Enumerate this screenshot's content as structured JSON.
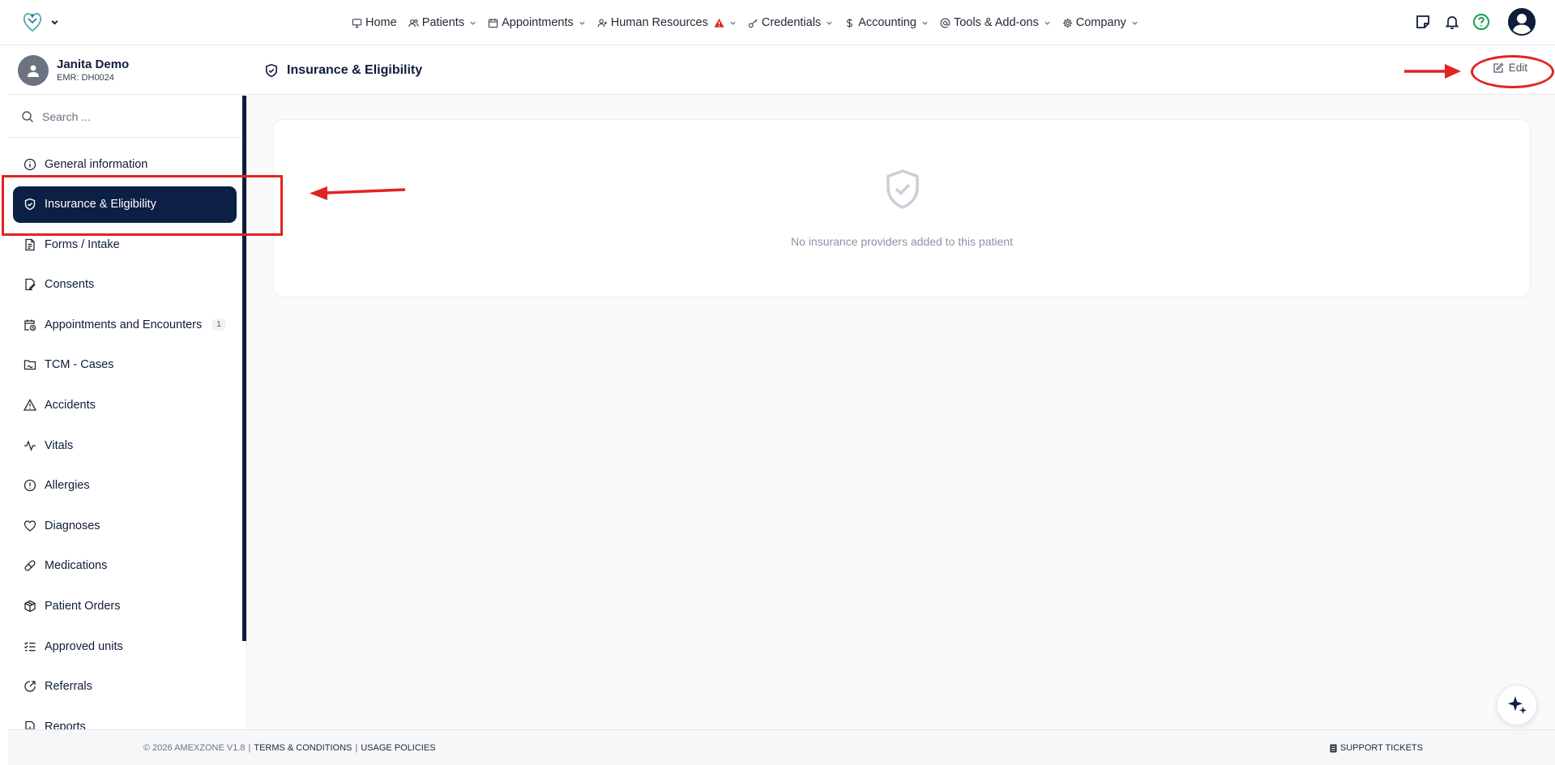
{
  "nav": {
    "items": [
      {
        "label": "Home",
        "icon": "monitor-icon",
        "dropdown": false
      },
      {
        "label": "Patients",
        "icon": "users-icon",
        "dropdown": true
      },
      {
        "label": "Appointments",
        "icon": "calendar-icon",
        "dropdown": true
      },
      {
        "label": "Human Resources",
        "icon": "user-plus-icon",
        "dropdown": true,
        "alert": true
      },
      {
        "label": "Credentials",
        "icon": "key-icon",
        "dropdown": true
      },
      {
        "label": "Accounting",
        "icon": "dollar-icon",
        "dropdown": true
      },
      {
        "label": "Tools & Add-ons",
        "icon": "at-icon",
        "dropdown": true
      },
      {
        "label": "Company",
        "icon": "gear-icon",
        "dropdown": true
      }
    ]
  },
  "patient": {
    "name": "Janita Demo",
    "emr": "EMR: DH0024"
  },
  "search": {
    "placeholder": "Search ..."
  },
  "sidebar": {
    "items": [
      {
        "label": "General information",
        "icon": "info-icon"
      },
      {
        "label": "Insurance & Eligibility",
        "icon": "shield-check-icon",
        "active": true
      },
      {
        "label": "Forms / Intake",
        "icon": "document-icon"
      },
      {
        "label": "Consents",
        "icon": "file-signature-icon"
      },
      {
        "label": "Appointments and Encounters",
        "icon": "calendar-clock-icon",
        "badge": "1"
      },
      {
        "label": "TCM - Cases",
        "icon": "folder-icon"
      },
      {
        "label": "Accidents",
        "icon": "warning-icon"
      },
      {
        "label": "Vitals",
        "icon": "activity-icon"
      },
      {
        "label": "Allergies",
        "icon": "alert-circle-icon"
      },
      {
        "label": "Diagnoses",
        "icon": "heart-icon"
      },
      {
        "label": "Medications",
        "icon": "pill-icon"
      },
      {
        "label": "Patient Orders",
        "icon": "package-icon"
      },
      {
        "label": "Approved units",
        "icon": "checklist-icon"
      },
      {
        "label": "Referrals",
        "icon": "referral-icon"
      },
      {
        "label": "Reports",
        "icon": "report-icon"
      }
    ]
  },
  "main": {
    "title": "Insurance & Eligibility",
    "edit_label": "Edit",
    "empty_message": "No insurance providers added to this patient"
  },
  "footer": {
    "copyright": "© 2026 AMEXZONE V1.8",
    "sep": "|",
    "terms": "TERMS & CONDITIONS",
    "usage": "USAGE POLICIES",
    "support": "SUPPORT TICKETS"
  },
  "colors": {
    "primary": "#0c1f44",
    "annotation": "#e02424",
    "help": "#16a34a",
    "alert": "#dc2626"
  }
}
